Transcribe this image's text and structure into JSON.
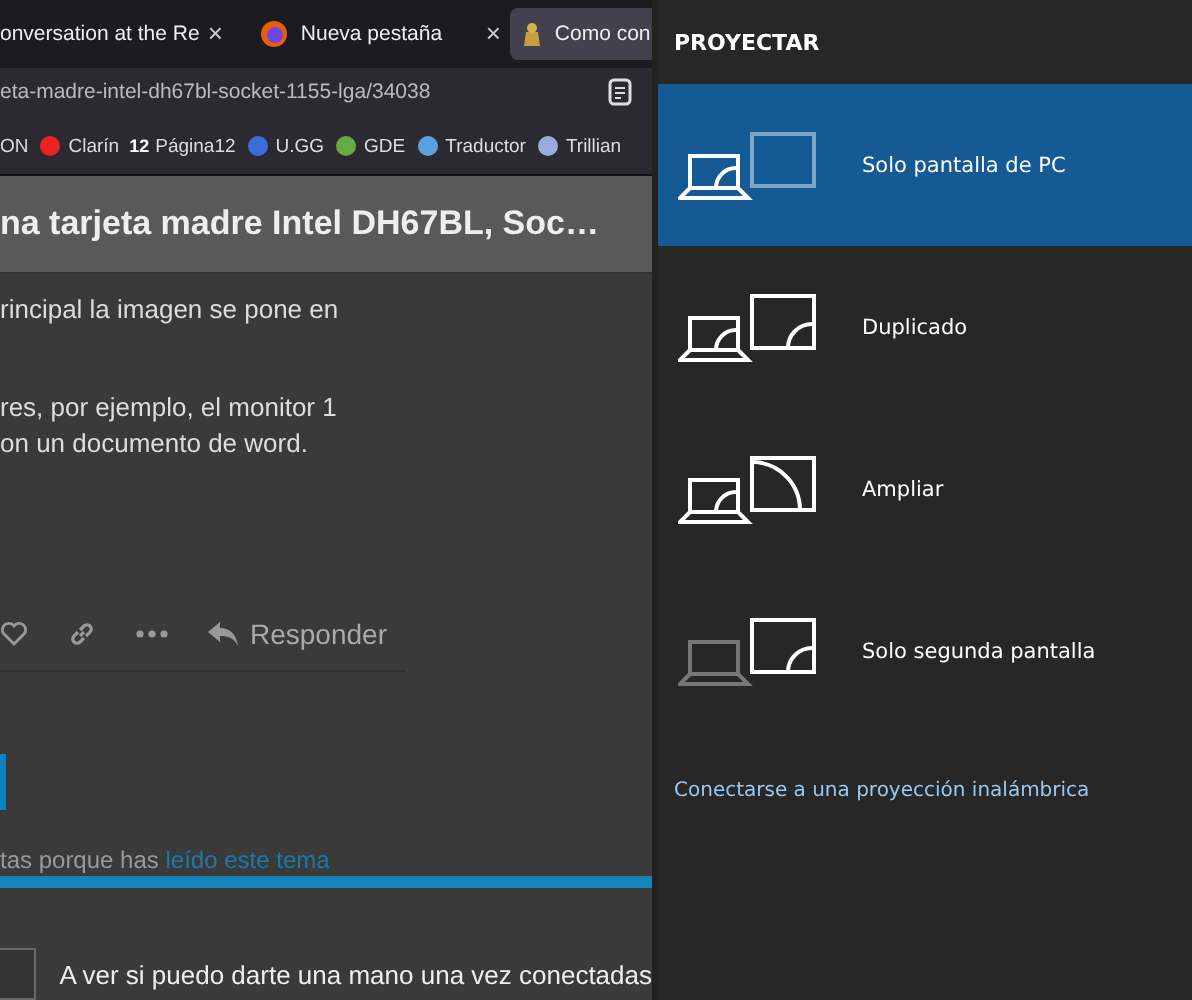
{
  "browser": {
    "tabs": [
      {
        "title": "onversation at the Re",
        "close": "×",
        "selected": false
      },
      {
        "title": "Nueva pestaña",
        "close": "×",
        "selected": false
      },
      {
        "title": "Como con",
        "selected": true
      }
    ],
    "url": "eta-madre-intel-dh67bl-socket-1155-lga/34038",
    "bookmarks": [
      {
        "label": "ON"
      },
      {
        "label": "Clarín"
      },
      {
        "label": "Página12",
        "logo": "12"
      },
      {
        "label": "U.GG"
      },
      {
        "label": "GDE"
      },
      {
        "label": "Traductor"
      },
      {
        "label": "Trillian"
      }
    ]
  },
  "topic": {
    "title": "na tarjeta madre Intel DH67BL, Soc…",
    "post_paragraphs": [
      [
        "rincipal la imagen se pone en"
      ],
      [
        "res, por ejemplo, el monitor 1",
        "on un documento de word."
      ]
    ],
    "reply_label": "Responder",
    "notice": {
      "text": "tas porque has ",
      "link": "leído este tema"
    },
    "reply_text": "A ver si puedo darte una mano una vez conectadas"
  },
  "project": {
    "title": "PROYECTAR",
    "modes": [
      {
        "label": "Solo pantalla de PC",
        "kind": "pc_only",
        "selected": true
      },
      {
        "label": "Duplicado",
        "kind": "duplicate",
        "selected": false
      },
      {
        "label": "Ampliar",
        "kind": "extend",
        "selected": false
      },
      {
        "label": "Solo segunda pantalla",
        "kind": "second_only",
        "selected": false
      }
    ],
    "wireless_link": "Conectarse a una proyección inalámbrica"
  }
}
